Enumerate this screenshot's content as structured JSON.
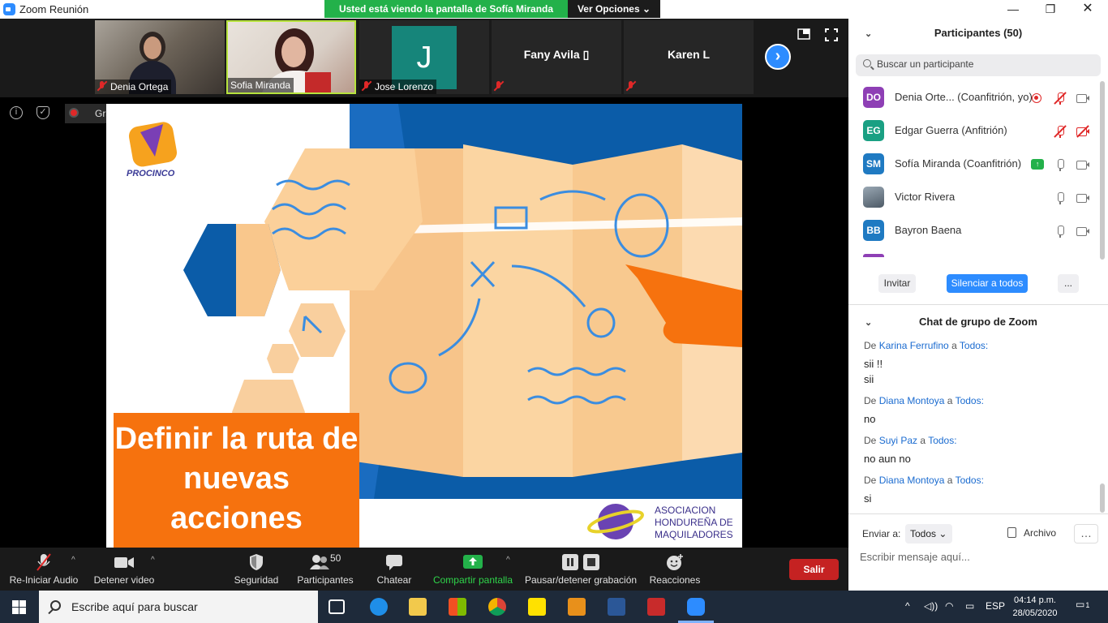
{
  "window": {
    "title": "Zoom Reunión",
    "share_banner": "Usted está viendo la pantalla de Sofía Miranda",
    "view_options": "Ver Opciones ⌄"
  },
  "video_tiles": [
    {
      "name": "Denia Ortega",
      "muted": true
    },
    {
      "name": "Sofia Miranda",
      "muted": false
    },
    {
      "name": "Jose Lorenzo",
      "muted": true,
      "avatar": "J"
    },
    {
      "name": "Fany Avila ▯",
      "muted": true
    },
    {
      "name": "Karen L",
      "muted": true
    }
  ],
  "status": {
    "recording": "Grabando..."
  },
  "slide": {
    "title": "Definir la ruta de nuevas acciones",
    "logo_text": "PROCINCO",
    "association": [
      "ASOCIACION",
      "HONDUREÑA DE",
      "MAQUILADORES"
    ]
  },
  "toolbar": {
    "audio": "Re-Iniciar Audio",
    "video": "Detener video",
    "security": "Seguridad",
    "participants": "Participantes",
    "participants_count": "50",
    "chat": "Chatear",
    "share": "Compartir pantalla",
    "record": "Pausar/detener grabación",
    "reactions": "Reacciones",
    "exit": "Salir"
  },
  "participants_panel": {
    "header": "Participantes (50)",
    "search_placeholder": "Buscar un participante",
    "list": [
      {
        "initials": "DO",
        "name": "Denia Orte...  (Coanfitrión, yo)",
        "color": "#8e3fb5"
      },
      {
        "initials": "EG",
        "name": "Edgar Guerra (Anfitrión)",
        "color": "#1aa083"
      },
      {
        "initials": "SM",
        "name": "Sofía Miranda (Coanfitrión)",
        "color": "#1f7ac2"
      },
      {
        "initials": "",
        "name": "Victor Rivera",
        "color": "#7a8a96"
      },
      {
        "initials": "BB",
        "name": "Bayron Baena",
        "color": "#1f7ac2"
      }
    ],
    "invite": "Invitar",
    "mute_all": "Silenciar a todos",
    "more": "..."
  },
  "chat": {
    "header": "Chat de grupo de Zoom",
    "messages": [
      {
        "prefix": "De",
        "from": "Karina Ferrufino",
        "sep": "a",
        "to": "Todos:",
        "body": [
          "sii !!",
          "sii"
        ]
      },
      {
        "prefix": "De",
        "from": "Diana Montoya",
        "sep": "a",
        "to": "Todos:",
        "body": [
          "no"
        ]
      },
      {
        "prefix": "De",
        "from": "Suyi Paz",
        "sep": "a",
        "to": "Todos:",
        "body": [
          "no aun no"
        ]
      },
      {
        "prefix": "De",
        "from": "Diana Montoya",
        "sep": "a",
        "to": "Todos:",
        "body": [
          "si"
        ]
      }
    ],
    "send_to_label": "Enviar a:",
    "send_to_value": "Todos ⌄",
    "file": "Archivo",
    "input_placeholder": "Escribir mensaje aquí..."
  },
  "taskbar": {
    "search_placeholder": "Escribe aquí para buscar",
    "language": "ESP",
    "time": "04:14 p.m.",
    "date": "28/05/2020",
    "notifications": "1"
  },
  "colors": {
    "zoom_blue": "#2d8cff",
    "share_green": "#23b14a",
    "exit_red": "#c52222",
    "slide_orange": "#f6720e",
    "slide_blue": "#0b5ca8"
  }
}
